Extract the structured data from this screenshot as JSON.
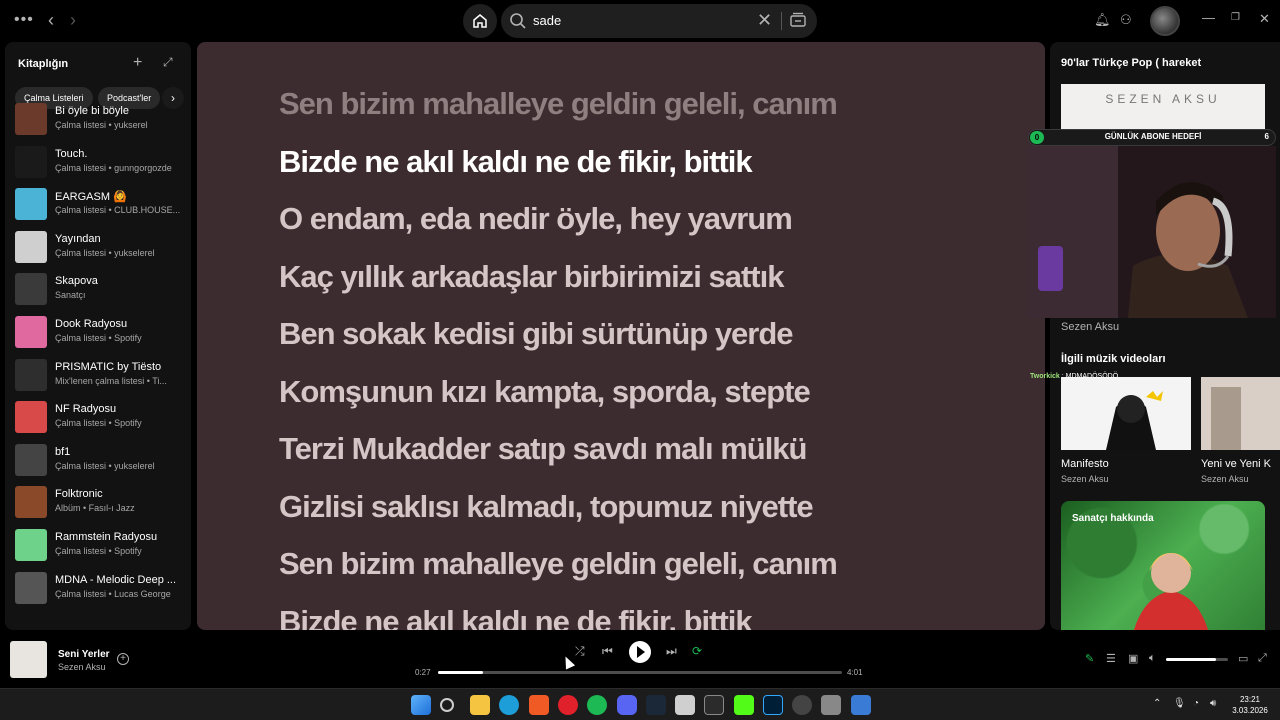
{
  "search": {
    "value": "sade"
  },
  "library": {
    "title": "Kitaplığın",
    "filters": [
      "Çalma Listeleri",
      "Podcast'ler"
    ],
    "items": [
      {
        "name": "Bi öyle bi böyle",
        "sub": "Çalma listesi • yukserel",
        "color": "#6b3a2a"
      },
      {
        "name": "Touch.",
        "sub": "Çalma listesi • gunngorgozde",
        "color": "#1a1a1a"
      },
      {
        "name": "EARGASM 🙆",
        "sub": "Çalma listesi • CLUB.HOUSE...",
        "color": "#4ab3d6"
      },
      {
        "name": "Yayından",
        "sub": "Çalma listesi • yukselerel",
        "color": "#cfcfcf"
      },
      {
        "name": "Skapova",
        "sub": "Sanatçı",
        "color": "#3a3a3a"
      },
      {
        "name": "Dook Radyosu",
        "sub": "Çalma listesi • Spotify",
        "color": "#e06aa0"
      },
      {
        "name": "PRISMATIC by Tiësto",
        "sub": "Mix'lenen çalma listesi • Ti...",
        "color": "#2e2e2e"
      },
      {
        "name": "NF Radyosu",
        "sub": "Çalma listesi • Spotify",
        "color": "#d84a4a"
      },
      {
        "name": "bf1",
        "sub": "Çalma listesi • yukselerel",
        "color": "#444444"
      },
      {
        "name": "Folktronic",
        "sub": "Albüm • Fasıl-ı Jazz",
        "color": "#8a4a2a"
      },
      {
        "name": "Rammstein Radyosu",
        "sub": "Çalma listesi • Spotify",
        "color": "#6fd28a"
      },
      {
        "name": "MDNA - Melodic Deep ...",
        "sub": "Çalma listesi • Lucas George",
        "color": "#555555"
      }
    ]
  },
  "lyrics": [
    {
      "text": "Sen bizim mahalleye geldin geleli, canım",
      "state": "past"
    },
    {
      "text": "Bizde ne akıl kaldı ne de fikir, bittik",
      "state": "active"
    },
    {
      "text": "O endam, eda nedir öyle, hey yavrum",
      "state": "future"
    },
    {
      "text": "Kaç yıllık arkadaşlar birbirimizi sattık",
      "state": "future"
    },
    {
      "text": "Ben sokak kedisi gibi sürtünüp yerde",
      "state": "future"
    },
    {
      "text": "Komşunun kızı kampta, sporda, stepte",
      "state": "future"
    },
    {
      "text": "Terzi Mukadder satıp savdı malı mülkü",
      "state": "future"
    },
    {
      "text": "Gizlisi saklısı kalmadı, topumuz niyette",
      "state": "future"
    },
    {
      "text": "Sen bizim mahalleye geldin geleli, canım",
      "state": "future"
    },
    {
      "text": "Bizde ne akıl kaldı ne de fikir, bittik",
      "state": "future"
    }
  ],
  "right_panel": {
    "playlist_title": "90'lar Türkçe Pop ( hareket",
    "cover_text": "SEZEN AKSU",
    "artist": "Sezen Aksu",
    "related_title": "İlgili müzik videoları",
    "videos": [
      {
        "title": "Manifesto",
        "artist": "Sezen Aksu"
      },
      {
        "title": "Yeni ve Yeni K",
        "artist": "Sezen Aksu"
      }
    ],
    "about_label": "Sanatçı hakkında"
  },
  "overlay": {
    "goal_left": "0",
    "goal_label": "GÜNLÜK ABONE HEDEFİ",
    "goal_right": "6",
    "chat_user": "Tworkick",
    "chat_msg": ": MDMADÖSÖDÖ"
  },
  "player": {
    "title": "Seni Yerler",
    "artist": "Sezen Aksu",
    "elapsed": "0:27",
    "duration": "4:01",
    "progress": 0.112,
    "volume": 0.8
  },
  "clock": {
    "time": "23:21",
    "date": "3.03.2026"
  },
  "colors": {
    "accent": "#1db954",
    "lyrics_bg": "#3d2c2f"
  }
}
